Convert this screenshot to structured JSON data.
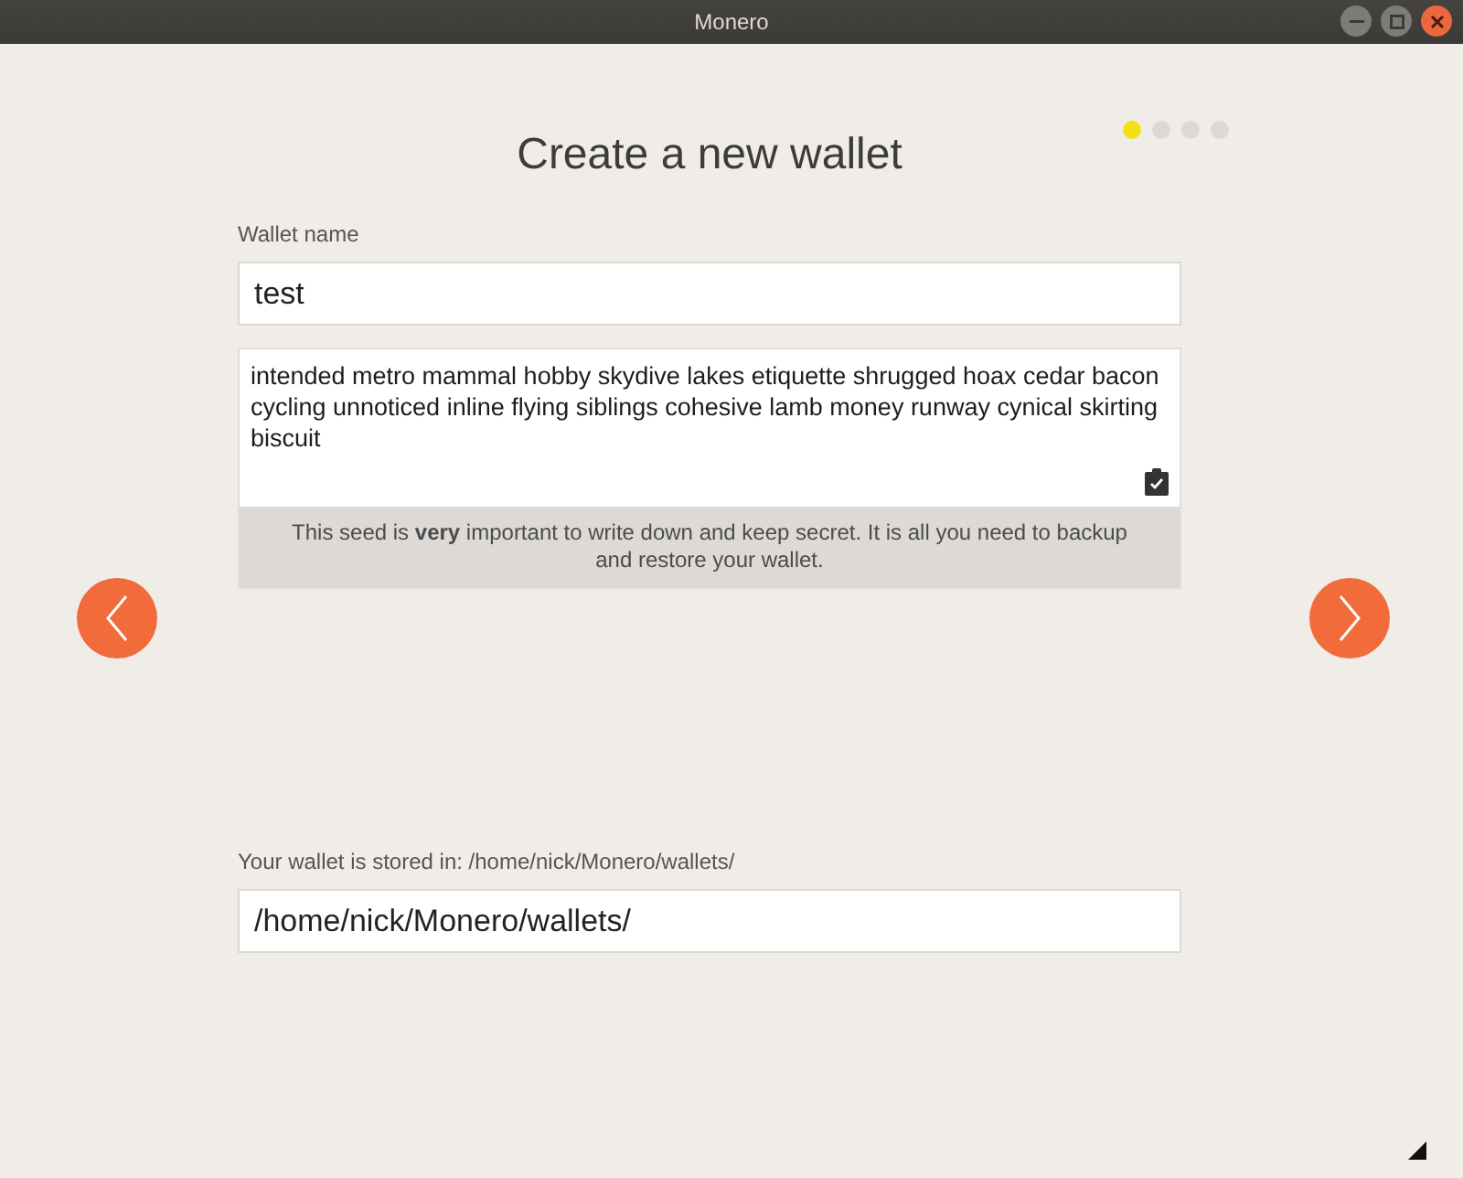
{
  "window": {
    "title": "Monero"
  },
  "steps": [
    {
      "selected": true
    },
    {
      "selected": false
    },
    {
      "selected": false
    },
    {
      "selected": false
    }
  ],
  "heading": "Create a new wallet",
  "wallet_name": {
    "label": "Wallet name",
    "value": "test"
  },
  "seed": {
    "words": "intended metro mammal hobby skydive lakes etiquette shrugged hoax cedar bacon cycling unnoticed inline flying siblings cohesive lamb money runway cynical skirting biscuit",
    "warning": "This seed is **very** important to write down and keep secret. It is all you need to backup and restore your wallet."
  },
  "location": {
    "label": "Your wallet is stored in: /home/nick/Monero/wallets/",
    "value": "/home/nick/Monero/wallets/"
  }
}
